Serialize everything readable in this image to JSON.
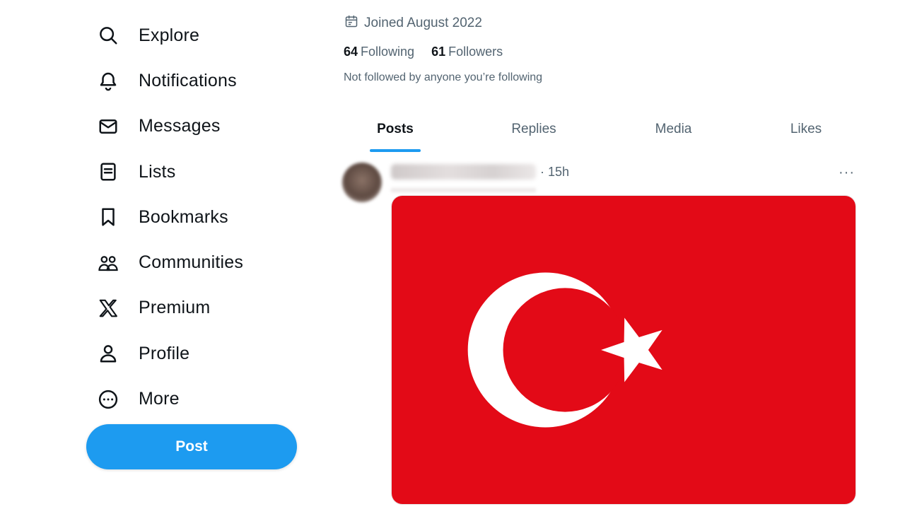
{
  "sidebar": {
    "items": [
      {
        "label": "Explore",
        "icon": "search-icon"
      },
      {
        "label": "Notifications",
        "icon": "bell-icon"
      },
      {
        "label": "Messages",
        "icon": "envelope-icon"
      },
      {
        "label": "Lists",
        "icon": "list-icon"
      },
      {
        "label": "Bookmarks",
        "icon": "bookmark-icon"
      },
      {
        "label": "Communities",
        "icon": "communities-icon"
      },
      {
        "label": "Premium",
        "icon": "x-logo-icon"
      },
      {
        "label": "Profile",
        "icon": "person-icon"
      },
      {
        "label": "More",
        "icon": "more-circle-icon"
      }
    ],
    "post_button": "Post"
  },
  "profile": {
    "joined": "Joined August 2022",
    "following_count": "64",
    "following_label": "Following",
    "followers_count": "61",
    "followers_label": "Followers",
    "not_followed": "Not followed by anyone you’re following"
  },
  "tabs": [
    {
      "label": "Posts",
      "active": true
    },
    {
      "label": "Replies",
      "active": false
    },
    {
      "label": "Media",
      "active": false
    },
    {
      "label": "Likes",
      "active": false
    }
  ],
  "post": {
    "time": "· 15h",
    "more": "···",
    "image": "turkish-flag"
  },
  "colors": {
    "accent": "#1d9bf0",
    "text": "#0f1419",
    "secondary_text": "#536471",
    "flag_red": "#e30a17",
    "flag_white": "#ffffff"
  }
}
